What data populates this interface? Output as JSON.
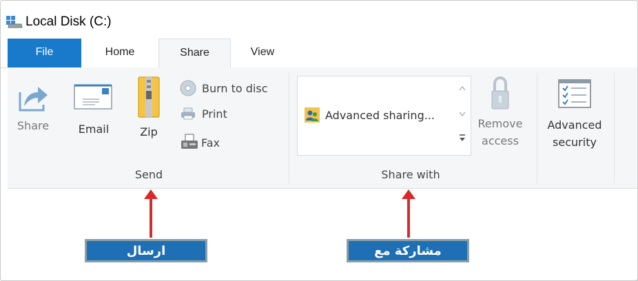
{
  "window": {
    "title": "Local Disk (C:)"
  },
  "tabs": [
    {
      "label": "File"
    },
    {
      "label": "Home"
    },
    {
      "label": "Share"
    },
    {
      "label": "View"
    }
  ],
  "ribbon": {
    "send": {
      "group_label": "Send",
      "share_label": "Share",
      "email_label": "Email",
      "zip_label": "Zip",
      "burn_label": "Burn to disc",
      "print_label": "Print",
      "fax_label": "Fax"
    },
    "share_with": {
      "group_label": "Share with",
      "advanced_sharing_label": "Advanced sharing...",
      "remove_access_line1": "Remove",
      "remove_access_line2": "access"
    },
    "advanced_security": {
      "line1": "Advanced",
      "line2": "security"
    }
  },
  "annotations": {
    "send_caption": "ارسال",
    "share_with_caption": "مشاركة مع"
  }
}
